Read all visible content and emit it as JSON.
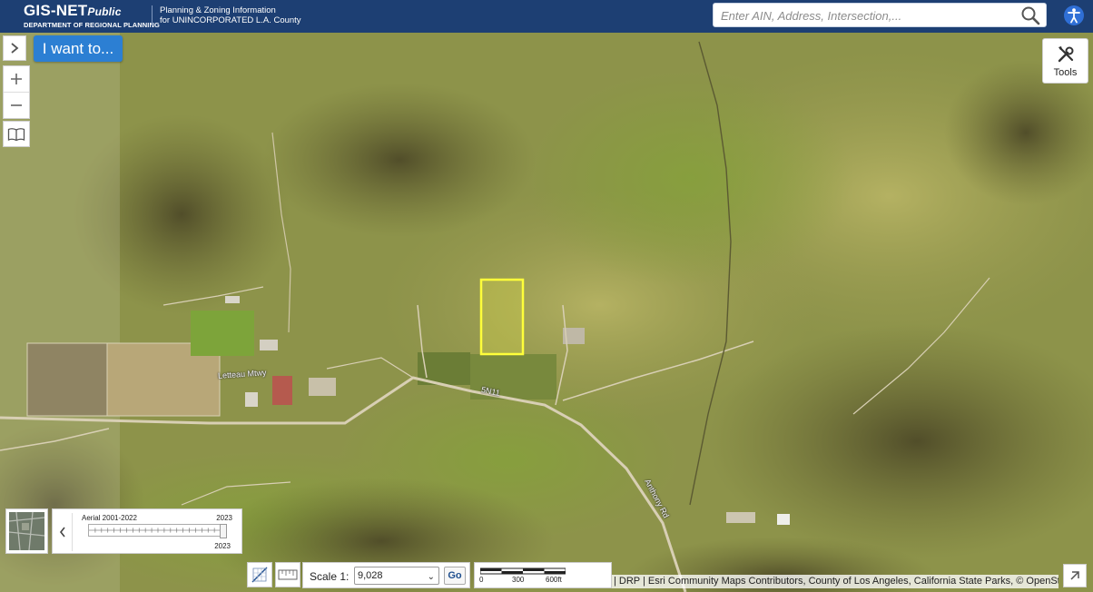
{
  "header": {
    "brand_main": "GIS-NET",
    "brand_italic": "Public",
    "brand_dept": "DEPARTMENT OF REGIONAL PLANNING",
    "tagline_line1": "Planning & Zoning Information",
    "tagline_line2": "for UNINCORPORATED L.A. County",
    "search_placeholder": "Enter AIN, Address, Intersection,...",
    "search_icon": "search-icon",
    "accessibility_icon": "accessibility-icon"
  },
  "map": {
    "i_want_to_label": "I want to...",
    "tools_label": "Tools",
    "labels": {
      "letteau": "Letteau Mtwy",
      "road_5n11": "5N11",
      "anthony": "Anthony Rd"
    },
    "parcel_highlight_color": "#ffff3a"
  },
  "bottom": {
    "timeline_title": "Aerial 2001-2022",
    "timeline_max": "2023",
    "timeline_min": "2023",
    "timeline_value": 1.0,
    "scale_label": "Scale 1:",
    "scale_value": "9,028",
    "go_label": "Go",
    "scalebar_labels": [
      "0",
      "300",
      "600ft"
    ],
    "attribution": "| DRP | Esri Community Maps Contributors, County of Los Angeles, California State Parks, © OpenStr..."
  }
}
